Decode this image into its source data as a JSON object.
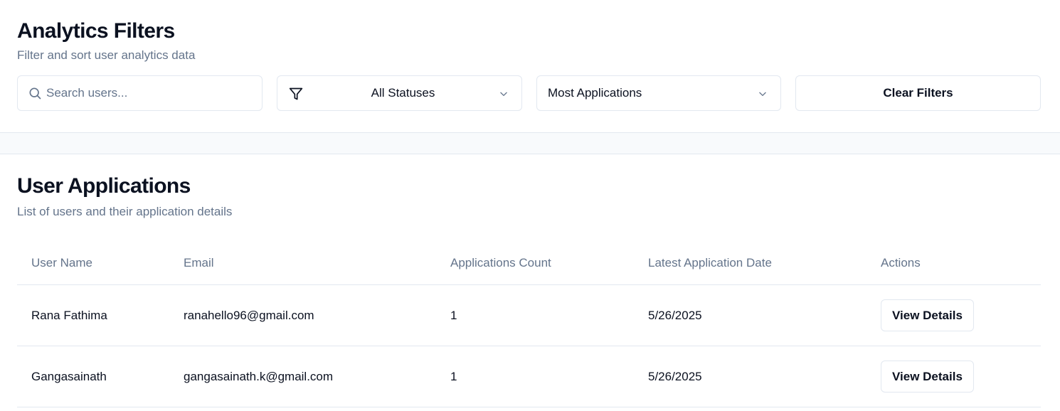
{
  "filters": {
    "title": "Analytics Filters",
    "subtitle": "Filter and sort user analytics data",
    "search": {
      "placeholder": "Search users...",
      "value": "",
      "icon": "search-icon"
    },
    "status_select": {
      "value": "All Statuses",
      "icon": "filter-icon"
    },
    "sort_select": {
      "value": "Most Applications"
    },
    "clear_label": "Clear Filters"
  },
  "applications": {
    "title": "User Applications",
    "subtitle": "List of users and their application details",
    "columns": [
      "User Name",
      "Email",
      "Applications Count",
      "Latest Application Date",
      "Actions"
    ],
    "rows": [
      {
        "name": "Rana Fathima",
        "email": "ranahello96@gmail.com",
        "count": "1",
        "date": "5/26/2025",
        "action": "View Details"
      },
      {
        "name": "Gangasainath",
        "email": "gangasainath.k@gmail.com",
        "count": "1",
        "date": "5/26/2025",
        "action": "View Details"
      }
    ]
  },
  "colors": {
    "text": "#0b1120",
    "muted": "#64748b",
    "border": "#e2e8f0",
    "band": "#f8fafc"
  }
}
